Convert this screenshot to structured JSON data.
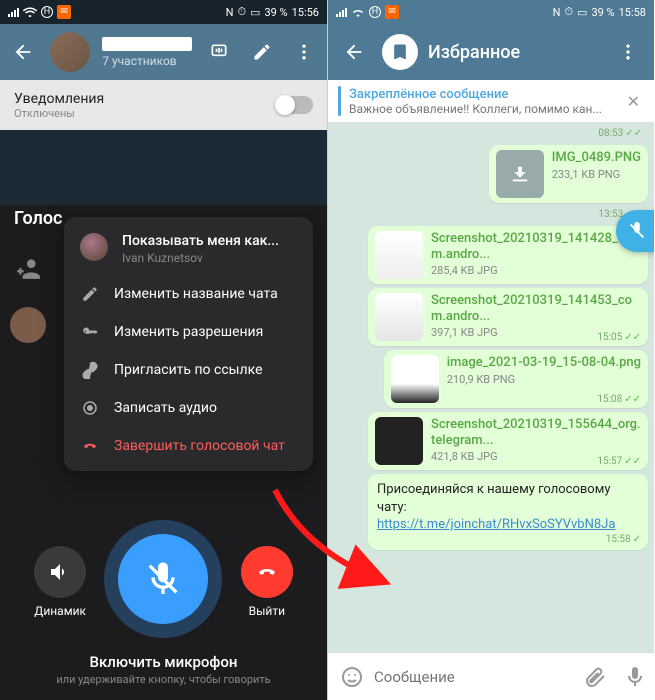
{
  "left": {
    "status": {
      "battery": "39 %",
      "time": "15:56",
      "nfc": "N"
    },
    "chat": {
      "members": "7 участников"
    },
    "notif": {
      "title": "Уведомления",
      "sub": "Отключены"
    },
    "vc": {
      "title": "Голос",
      "menu": {
        "showas": {
          "title": "Показывать меня как...",
          "sub": "Ivan Kuznetsov"
        },
        "rename": "Изменить название чата",
        "perms": "Изменить разрешения",
        "invite": "Пригласить по ссылке",
        "record": "Записать аудио",
        "end": "Завершить голосовой чат"
      },
      "controls": {
        "speaker": "Динамик",
        "mic": "",
        "leave": "Выйти"
      },
      "hint": {
        "h1": "Включить микрофон",
        "h2": "или удерживайте кнопку, чтобы говорить"
      }
    }
  },
  "right": {
    "status": {
      "battery": "39 %",
      "time": "15:58",
      "nfc": "N"
    },
    "header": {
      "title": "Избранное"
    },
    "pinned": {
      "title": "Закреплённое сообщение",
      "sub": "Важное объявление!! Коллеги, помимо кан..."
    },
    "files": [
      {
        "name": "",
        "size": "",
        "time": "08:53"
      },
      {
        "name": "IMG_0489.PNG",
        "size": "233,1 KB PNG",
        "time": "13:53"
      },
      {
        "name": "Screenshot_20210319_141428_com.andro...",
        "size": "285,4 KB JPG",
        "time": ""
      },
      {
        "name": "Screenshot_20210319_141453_com.andro...",
        "size": "397,1 KB JPG",
        "time": "15:05"
      },
      {
        "name": "image_2021-03-19_15-08-04.png",
        "size": "210,9 KB PNG",
        "time": "15:08"
      },
      {
        "name": "Screenshot_20210319_155644_org.telegram...",
        "size": "421,8 KB JPG",
        "time": "15:57"
      }
    ],
    "textmsg": {
      "pre": "Присоединяйся к нашему голосовому чату: ",
      "link": "https://t.me/joinchat/RHvxSoSYVvbN8Ja",
      "time": "15:58"
    },
    "composer": {
      "placeholder": "Сообщение"
    }
  }
}
